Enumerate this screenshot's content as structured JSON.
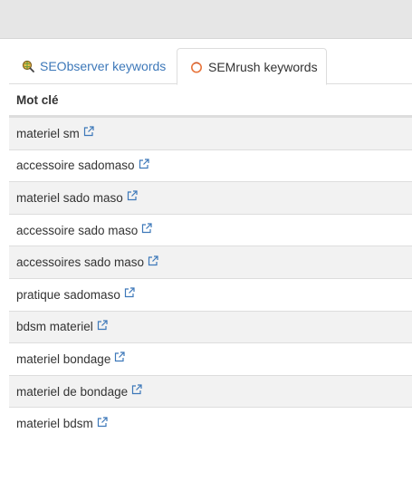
{
  "tabs": {
    "seobserver_label": "SEObserver keywords",
    "semrush_label": "SEMrush keywords",
    "active": "SEMrush keywords"
  },
  "table": {
    "header": "Mot clé",
    "rows": [
      "materiel sm",
      "accessoire sadomaso",
      "materiel sado maso",
      "accessoire sado maso",
      "accessoires sado maso",
      "pratique sadomaso",
      "bdsm materiel",
      "materiel bondage",
      "materiel de bondage",
      "materiel bdsm"
    ]
  },
  "colors": {
    "link": "#3d78b9",
    "row_stripe": "#f2f2f2",
    "topbar": "#e6e6e6"
  },
  "icons": {
    "seobserver": "magnifier-globe-icon",
    "semrush": "semrush-icon",
    "row_link": "external-link-icon"
  }
}
